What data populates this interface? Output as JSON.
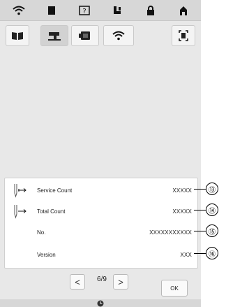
{
  "tabs": [
    {
      "icon": "wifi-icon"
    },
    {
      "icon": "page-icon"
    },
    {
      "icon": "help-icon"
    },
    {
      "icon": "sewing-settings-icon"
    },
    {
      "icon": "lock-icon"
    },
    {
      "icon": "home-icon"
    }
  ],
  "toolbar": [
    {
      "icon": "book-icon"
    },
    {
      "icon": "machine-icon",
      "selected": true
    },
    {
      "icon": "embroidery-frame-icon"
    },
    {
      "icon": "wifi-icon"
    },
    {
      "icon": "screen-capture-icon"
    }
  ],
  "info": {
    "rows": [
      {
        "label": "Service Count",
        "value": "XXXXX",
        "icon": "service-needle-icon"
      },
      {
        "label": "Total Count",
        "value": "XXXXX",
        "icon": "total-needle-icon"
      },
      {
        "label": "No.",
        "value": "XXXXXXXXXXX"
      },
      {
        "label": "Version",
        "value": "XXX"
      }
    ]
  },
  "pager": {
    "prev": "<",
    "page": "6/9",
    "next": ">"
  },
  "ok_label": "OK",
  "callouts": [
    "⑬",
    "⑭",
    "⑮",
    "⑯"
  ]
}
